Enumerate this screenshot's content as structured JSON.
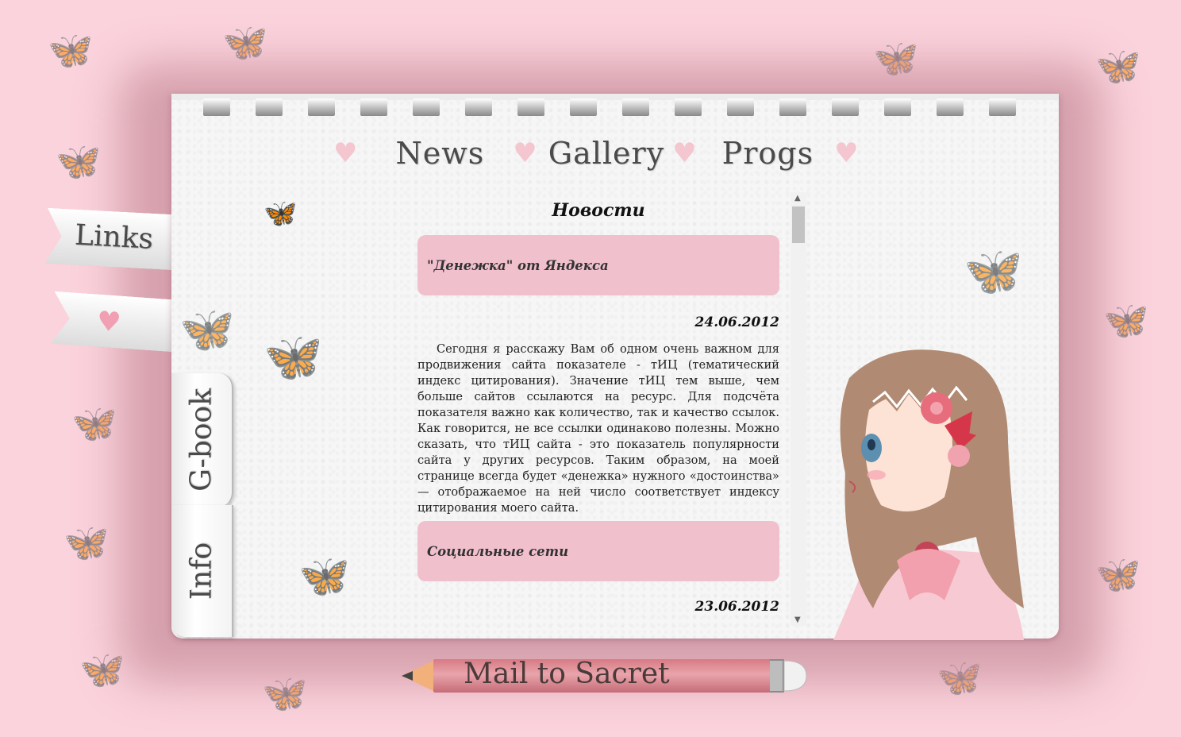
{
  "nav": {
    "items": [
      "News",
      "Gallery",
      "Progs"
    ]
  },
  "side_ribbons": {
    "links_label": "Links"
  },
  "side_tabs": {
    "gbook_label": "G-book",
    "info_label": "Info"
  },
  "content": {
    "section_title": "Новости",
    "news": [
      {
        "title": "\"Денежка\" от Яндекса",
        "date": "24.06.2012",
        "body": "Сегодня я расскажу Вам об одном очень важном для продвижения сайта показателе - тИЦ (тематический индекс цитирования). Значение тИЦ тем выше, чем больше сайтов ссылаются на ресурс. Для подсчёта показателя важно как количество, так и качество ссылок. Как говорится, не все ссылки одинаково полезны. Можно сказать, что тИЦ сайта - это показатель популярности сайта у других ресурсов. Таким образом, на моей странице всегда будет «денежка» нужного «достоинства» — отображаемое на ней число соответствует индексу цитирования моего сайта."
      },
      {
        "title": "Социальные сети",
        "date": "23.06.2012"
      }
    ]
  },
  "mail": {
    "label": "Mail to Sacret"
  },
  "colors": {
    "background": "#fbd3dc",
    "news_header": "#f1c0cd",
    "heart": "#f4c6cf"
  },
  "icons": {
    "heart": "heart-icon",
    "butterfly": "butterfly-icon",
    "pencil": "pencil-icon"
  }
}
